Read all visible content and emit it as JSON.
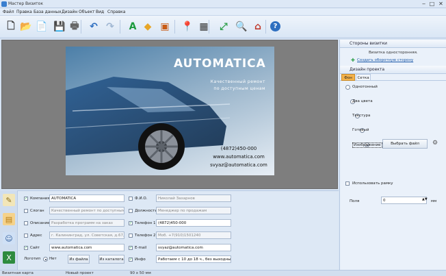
{
  "window": {
    "title": "Мастер Визиток",
    "controls": [
      "‒",
      "□",
      "✕"
    ]
  },
  "menu": [
    "Файл",
    "Правка",
    "База данных",
    "Дизайн",
    "Объект",
    "Вид",
    "Справка"
  ],
  "toolbar": [
    {
      "icon": "new-file-icon",
      "glyph": "🗋",
      "color": "#333"
    },
    {
      "icon": "open-folder-icon",
      "glyph": "📂",
      "color": "#c89a2c"
    },
    {
      "icon": "templates-icon",
      "glyph": "📄",
      "color": "#c9a040"
    },
    {
      "icon": "save-icon",
      "glyph": "💾",
      "color": "#4a5d7a"
    },
    {
      "icon": "print-icon",
      "glyph": "🖶",
      "color": "#666"
    },
    {
      "icon": "undo-icon",
      "glyph": "↶",
      "color": "#2e6fc0"
    },
    {
      "icon": "redo-icon",
      "glyph": "↷",
      "color": "#9fb6d2"
    },
    {
      "icon": "text-icon",
      "glyph": "A",
      "color": "#1b9a3c"
    },
    {
      "icon": "shapes-icon",
      "glyph": "◆",
      "color": "#e7a628"
    },
    {
      "icon": "image-icon",
      "glyph": "▣",
      "color": "#c85b16"
    },
    {
      "icon": "map-icon",
      "glyph": "📍",
      "color": "#3a8d3a"
    },
    {
      "icon": "qr-code-icon",
      "glyph": "▦",
      "color": "#333"
    },
    {
      "icon": "resize-icon",
      "glyph": "⤢",
      "color": "#2e9f4a"
    },
    {
      "icon": "preview-icon",
      "glyph": "🔍",
      "color": "#3c6db0"
    },
    {
      "icon": "publish-icon",
      "glyph": "⌂",
      "color": "#c0392b"
    },
    {
      "icon": "help-icon",
      "glyph": "?",
      "color": "#fff"
    }
  ],
  "card": {
    "name": "AUTOMATICA",
    "slogan_line1": "Качественный ремонт",
    "slogan_line2": "по доступным ценам",
    "phone": "(4872)450-000",
    "site": "www.automatica.com",
    "email": "svyaz@automatica.com"
  },
  "fields": {
    "company": {
      "label": "Компания",
      "value": "AUTOMATICA",
      "checked": true
    },
    "slogan": {
      "label": "Слоган",
      "value": "Качественный ремонт по доступным ценам",
      "checked": false
    },
    "description": {
      "label": "Описание",
      "value": "Разработка программ на заказ",
      "checked": false
    },
    "address": {
      "label": "Адрес",
      "value": "г. Калининград, ул. Советская, д.67, оф.30",
      "checked": false
    },
    "site": {
      "label": "Сайт",
      "value": "www.automatica.com",
      "checked": true
    },
    "fio": {
      "label": "Ф.И.О.",
      "value": "Николай Захарнов",
      "checked": false
    },
    "position": {
      "label": "Должность",
      "value": "Менеджер по продажам",
      "checked": false
    },
    "phone1": {
      "label": "Телефон 1",
      "value": "(4872)450-000",
      "checked": true
    },
    "phone2": {
      "label": "Телефон 2",
      "value": "Моб. +7(910)1501240",
      "checked": false
    },
    "email": {
      "label": "E-mail",
      "value": "svyaz@automatica.com",
      "checked": true
    },
    "info": {
      "label": "Инфо",
      "value": "Работаем с 10 до 18 ч., без выходных",
      "checked": true
    }
  },
  "logo": {
    "label": "Логотип",
    "options": [
      "Нет",
      "Из файла",
      "Из каталога"
    ]
  },
  "right": {
    "sides_header": "Стороны визитки",
    "sides_note": "Визитка односторонняя.",
    "create_back": "Создать оборотную сторону",
    "design_header": "Дизайн проекта",
    "tabs": [
      "Фон",
      "Сетка"
    ],
    "bg_options": [
      "Однотонный",
      "Два цвета",
      "Текстура",
      "Готовый",
      "Изображение"
    ],
    "choose_file": "Выбрать файл",
    "use_frame": "Использовать рамку",
    "field_label": "Поля",
    "field_value": "0",
    "field_unit": "мм"
  },
  "status": [
    "Визитная карта",
    "Новый проект",
    "90 x 50 мм"
  ],
  "colors": {
    "accent": "#3a7fd0",
    "panel": "#dde8f5",
    "link": "#1a58a8"
  }
}
